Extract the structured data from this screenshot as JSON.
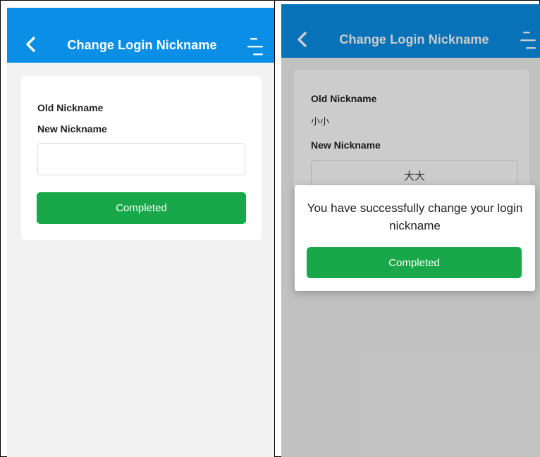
{
  "left_screen": {
    "header": {
      "title": "Change Login Nickname"
    },
    "form": {
      "old_label": "Old Nickname",
      "new_label": "New Nickname",
      "new_value": "",
      "submit_label": "Completed"
    }
  },
  "right_screen": {
    "header": {
      "title": "Change Login Nickname"
    },
    "form": {
      "old_label": "Old Nickname",
      "old_value": "小小",
      "new_label": "New Nickname",
      "new_value": "大大"
    },
    "dialog": {
      "message": "You have successfully change your login nickname",
      "button_label": "Completed"
    }
  },
  "icons": {
    "back": "chevron-left-icon",
    "menu": "menu-icon"
  },
  "colors": {
    "header_blue": "#0b8fe6",
    "button_green": "#18a84a",
    "background_gray": "#f2f2f2"
  }
}
